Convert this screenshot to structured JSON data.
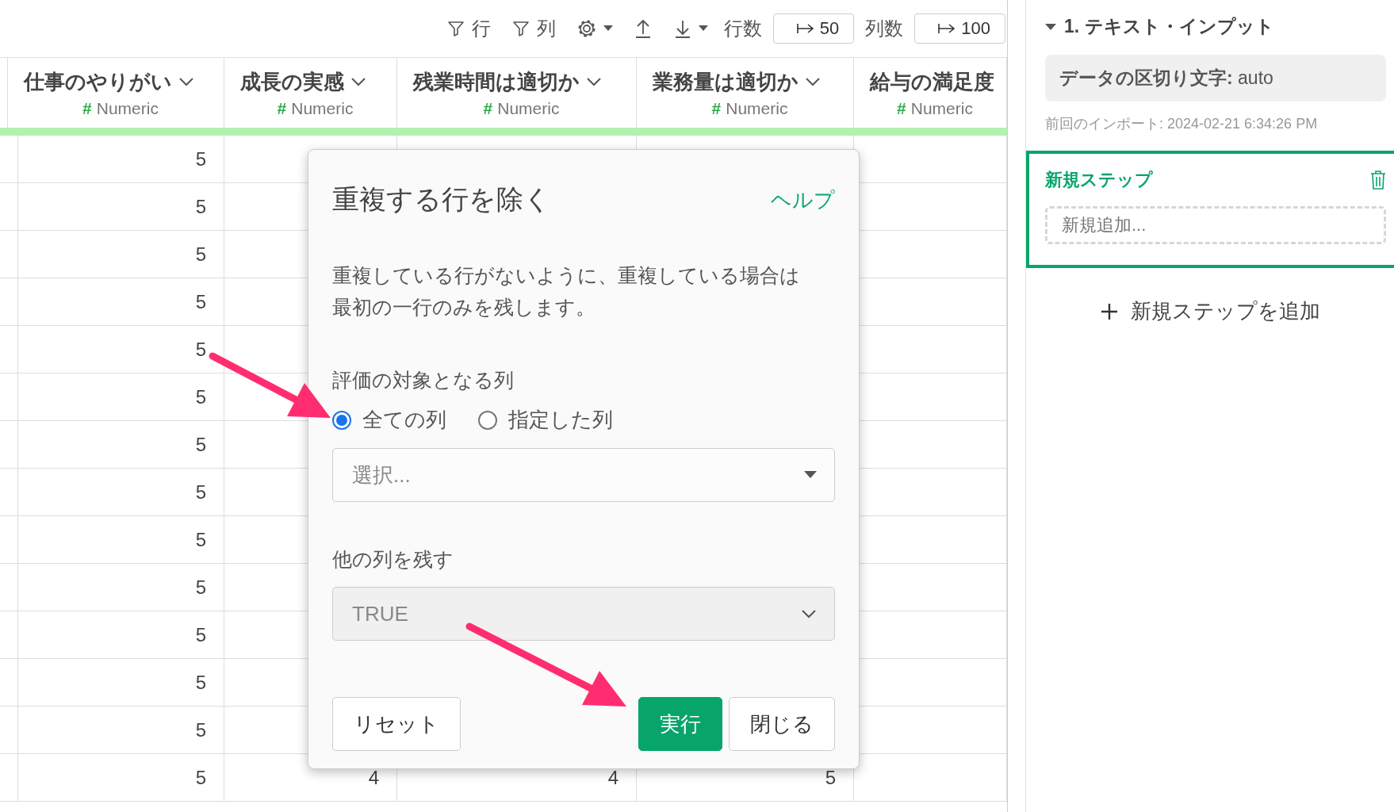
{
  "toolbar": {
    "row_filter": "行",
    "column_filter": "列",
    "row_count_label": "行数",
    "row_count": "50",
    "column_count_label": "列数",
    "column_count": "100"
  },
  "table": {
    "columns": [
      {
        "name": "仕事のやりがい",
        "type_mark": "#",
        "type": "Numeric"
      },
      {
        "name": "成長の実感",
        "type_mark": "#",
        "type": "Numeric"
      },
      {
        "name": "残業時間は適切か",
        "type_mark": "#",
        "type": "Numeric"
      },
      {
        "name": "業務量は適切か",
        "type_mark": "#",
        "type": "Numeric"
      },
      {
        "name": "給与の満足度",
        "type_mark": "#",
        "type": "Numeric"
      }
    ],
    "rows": [
      {
        "cells": [
          "5"
        ]
      },
      {
        "cells": [
          "5"
        ]
      },
      {
        "cells": [
          "5"
        ]
      },
      {
        "cells": [
          "5"
        ]
      },
      {
        "cells": [
          "5"
        ]
      },
      {
        "cells": [
          "5"
        ]
      },
      {
        "cells": [
          "5"
        ]
      },
      {
        "cells": [
          "5"
        ]
      },
      {
        "cells": [
          "5"
        ]
      },
      {
        "cells": [
          "5"
        ]
      },
      {
        "cells": [
          "5"
        ]
      },
      {
        "cells": [
          "5"
        ]
      },
      {
        "cells": [
          "5"
        ]
      },
      {
        "cells": [
          "5",
          "4",
          "4",
          "5"
        ]
      }
    ]
  },
  "dialog": {
    "title": "重複する行を除く",
    "help": "ヘルプ",
    "description": "重複している行がないように、重複している場合は最初の一行のみを残します。",
    "target_label": "評価の対象となる列",
    "target_options": [
      {
        "label": "全ての列",
        "selected": true
      },
      {
        "label": "指定した列",
        "selected": false
      }
    ],
    "column_select": {
      "placeholder": "選択..."
    },
    "keep_label": "他の列を残す",
    "keep_select": {
      "value": "TRUE",
      "disabled": true
    },
    "buttons": [
      {
        "label": "リセット",
        "kind": "secondary"
      },
      {
        "label": "実行",
        "kind": "primary"
      },
      {
        "label": "閉じる",
        "kind": "secondary"
      }
    ]
  },
  "sidebar": {
    "step": {
      "title": "1. テキスト・インプット",
      "expanded": true,
      "setting": "**データの区切り文字:** auto",
      "last_import": "前回のインポート: 2024-02-21 6:34:26 PM"
    },
    "new_step": {
      "title": "新規ステップ",
      "placeholder": "新規追加..."
    },
    "add_step": "新規ステップを追加"
  }
}
